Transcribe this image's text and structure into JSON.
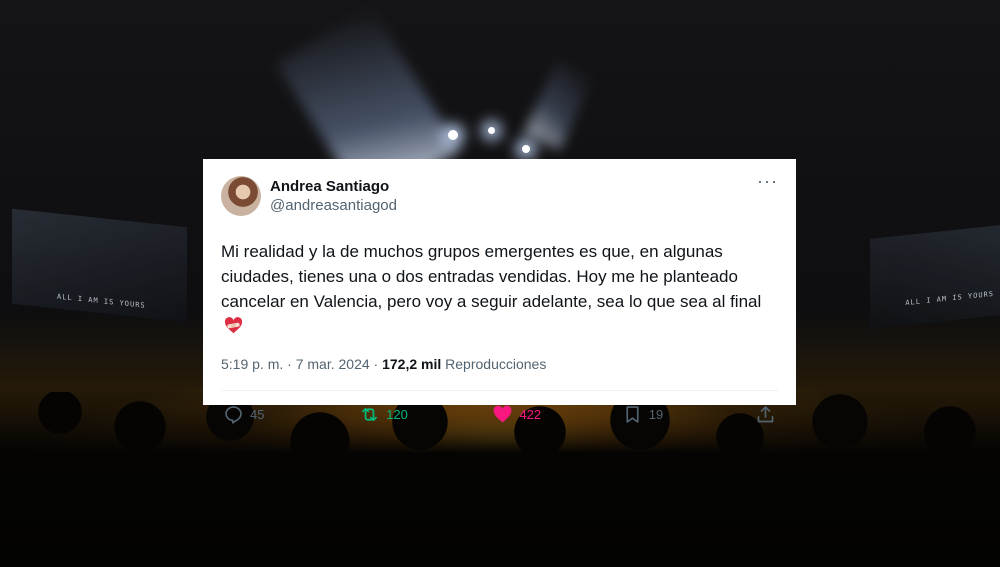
{
  "tweet": {
    "author_name": "Andrea Santiago",
    "author_handle": "@andreasantiagod",
    "text": "Mi realidad y la de muchos grupos emergentes es que, en algunas ciudades, tienes una o dos entradas vendidas. Hoy me he planteado cancelar en Valencia, pero voy a seguir adelante, sea lo que sea al final",
    "emoji": "heart-with-bandage",
    "time": "5:19 p. m.",
    "separator": "·",
    "date": "7 mar. 2024",
    "views_count": "172,2 mil",
    "views_label": "Reproducciones",
    "more_label": "···",
    "replies": "45",
    "retweets": "120",
    "likes": "422",
    "bookmarks": "19"
  },
  "background": {
    "screen_text": "ALL I AM IS YOURS"
  },
  "colors": {
    "retweet_green": "#00ba7c",
    "like_pink": "#f91880",
    "muted": "#536471",
    "text": "#0f1419"
  }
}
